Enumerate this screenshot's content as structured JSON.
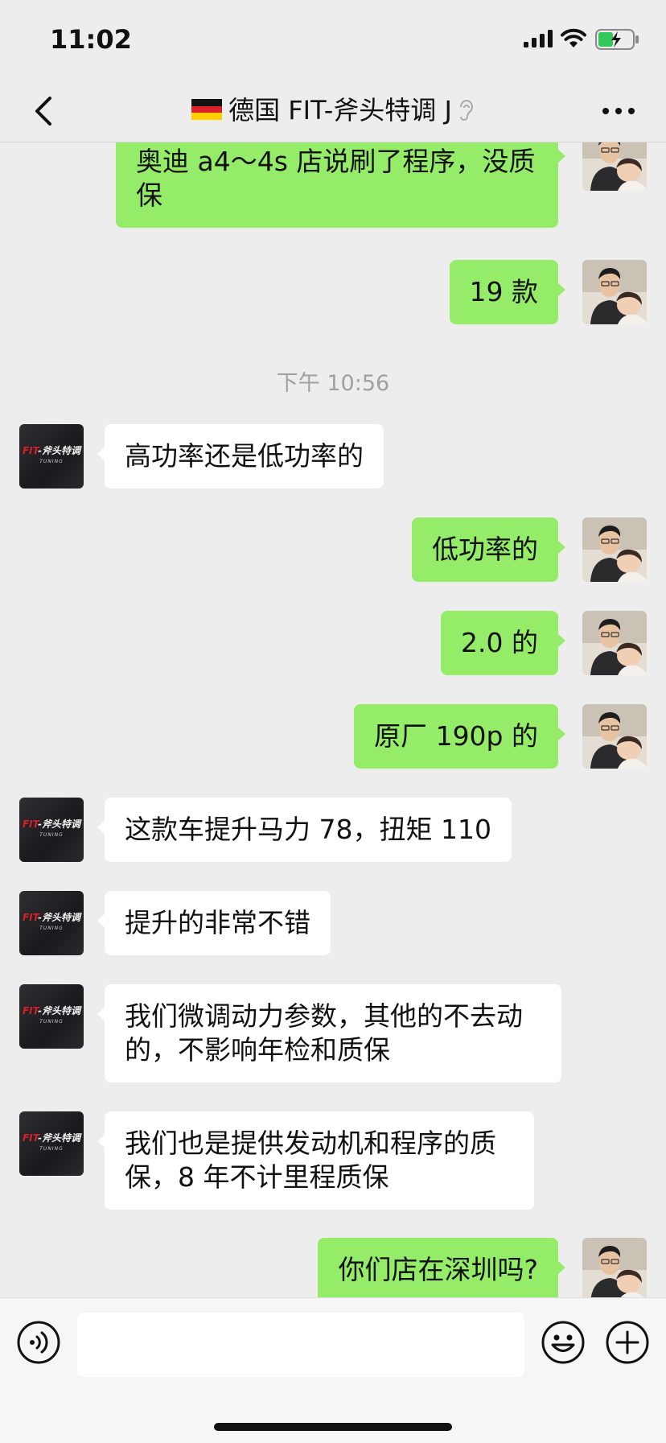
{
  "status_bar": {
    "time": "11:02"
  },
  "header": {
    "title": "德国 FIT-斧头特调 J"
  },
  "timestamp": "下午 10:56",
  "messages": [
    {
      "from": "me",
      "text": "奥迪 a4～4s 店说刷了程序，没质保"
    },
    {
      "from": "me",
      "text": "19 款"
    },
    {
      "from": "fit",
      "text": "高功率还是低功率的"
    },
    {
      "from": "me",
      "text": "低功率的"
    },
    {
      "from": "me",
      "text": "2.0 的"
    },
    {
      "from": "me",
      "text": "原厂 190p 的"
    },
    {
      "from": "fit",
      "text": "这款车提升马力 78，扭矩 110"
    },
    {
      "from": "fit",
      "text": "提升的非常不错"
    },
    {
      "from": "fit",
      "text": "我们微调动力参数，其他的不去动的，不影响年检和质保"
    },
    {
      "from": "fit",
      "text": "我们也是提供发动机和程序的质保，8 年不计里程质保"
    },
    {
      "from": "me",
      "text": "你们店在深圳吗?"
    }
  ],
  "fit_logo": {
    "brand": "FIT",
    "cn": "-斧头特调",
    "sub": "TUNING"
  },
  "colors": {
    "my_bubble": "#95ec69",
    "their_bubble": "#ffffff",
    "background": "#ededed"
  },
  "icons": [
    "back-icon",
    "more-icon",
    "voice-icon",
    "emoji-icon",
    "plus-icon",
    "signal-icon",
    "wifi-icon",
    "battery-icon",
    "ear-icon",
    "german-flag-icon"
  ]
}
